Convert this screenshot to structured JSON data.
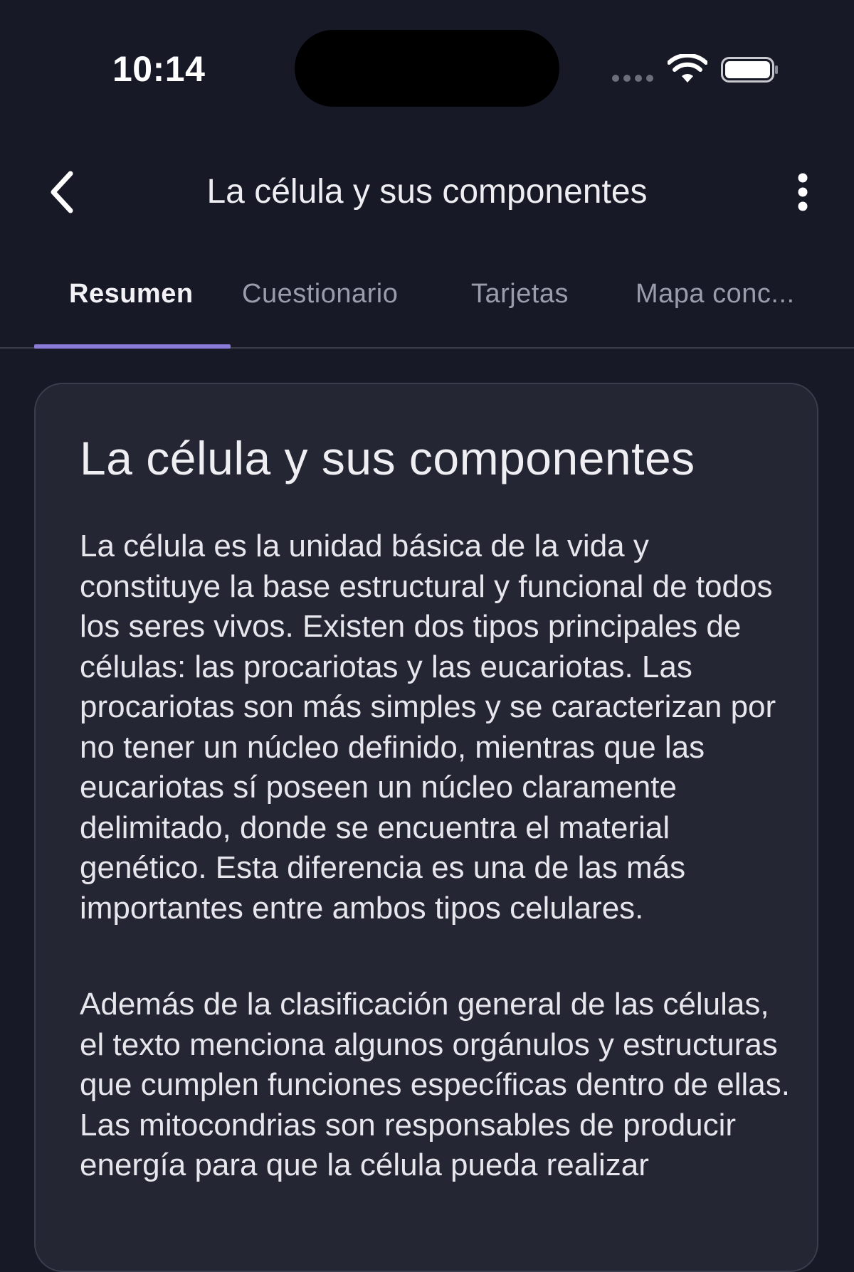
{
  "status_bar": {
    "time": "10:14"
  },
  "header": {
    "title": "La célula y sus componentes"
  },
  "tabs": [
    {
      "label": "Resumen",
      "active": true
    },
    {
      "label": "Cuestionario",
      "active": false
    },
    {
      "label": "Tarjetas",
      "active": false
    },
    {
      "label": "Mapa conc..."
    }
  ],
  "summary": {
    "title": "La célula y sus componentes",
    "paragraphs": [
      "La célula es la unidad básica de la vida y constituye la base estructural y funcional de todos los seres vivos. Existen dos tipos principales de células: las procariotas y las eucariotas. Las procariotas son más simples y se caracterizan por no tener un núcleo definido, mientras que las eucariotas sí poseen un núcleo claramente delimitado, donde se encuentra el material genético. Esta diferencia es una de las más importantes entre ambos tipos celulares.",
      "Además de la clasificación general de las células, el texto menciona algunos orgánulos y estructuras que cumplen funciones específicas dentro de ellas. Las mitocondrias son responsables de producir energía para que la célula pueda realizar"
    ]
  },
  "colors": {
    "background": "#171a26",
    "card_background": "#242634",
    "accent": "#8b7bd8",
    "inactive_tab": "#9a9cab"
  },
  "icons": {
    "back": "chevron-left-icon",
    "more": "more-vertical-icon",
    "wifi": "wifi-icon",
    "battery": "battery-icon"
  }
}
